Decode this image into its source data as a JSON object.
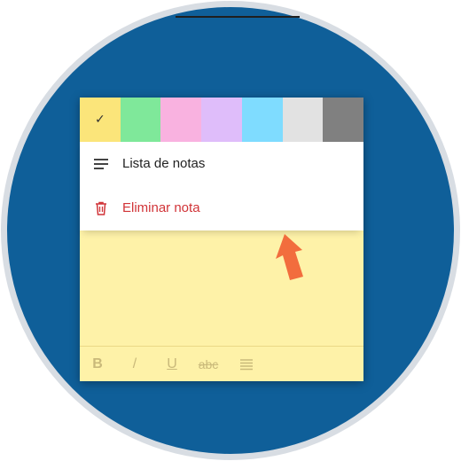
{
  "colors": {
    "swatches": [
      {
        "name": "yellow",
        "hex": "#fbe57a",
        "selected": true
      },
      {
        "name": "green",
        "hex": "#7fe89a",
        "selected": false
      },
      {
        "name": "pink",
        "hex": "#f9b2e0",
        "selected": false
      },
      {
        "name": "purple",
        "hex": "#dfbdfa",
        "selected": false
      },
      {
        "name": "blue",
        "hex": "#7fdcff",
        "selected": false
      },
      {
        "name": "gray",
        "hex": "#e2e2e2",
        "selected": false
      },
      {
        "name": "charcoal",
        "hex": "#808080",
        "selected": false
      }
    ],
    "check_glyph": "✓",
    "accent_red": "#d13438",
    "background_blue": "#0f5f99",
    "note_yellow": "#fef2a8"
  },
  "menu": {
    "items": [
      {
        "label": "Lista de notas",
        "icon": "list-lines-icon"
      },
      {
        "label": "Eliminar nota",
        "icon": "trash-icon"
      }
    ]
  },
  "format_bar": {
    "bold": "B",
    "italic": "/",
    "underline": "U",
    "strikethrough": "abc",
    "list_icon": "bullet-list-icon"
  }
}
